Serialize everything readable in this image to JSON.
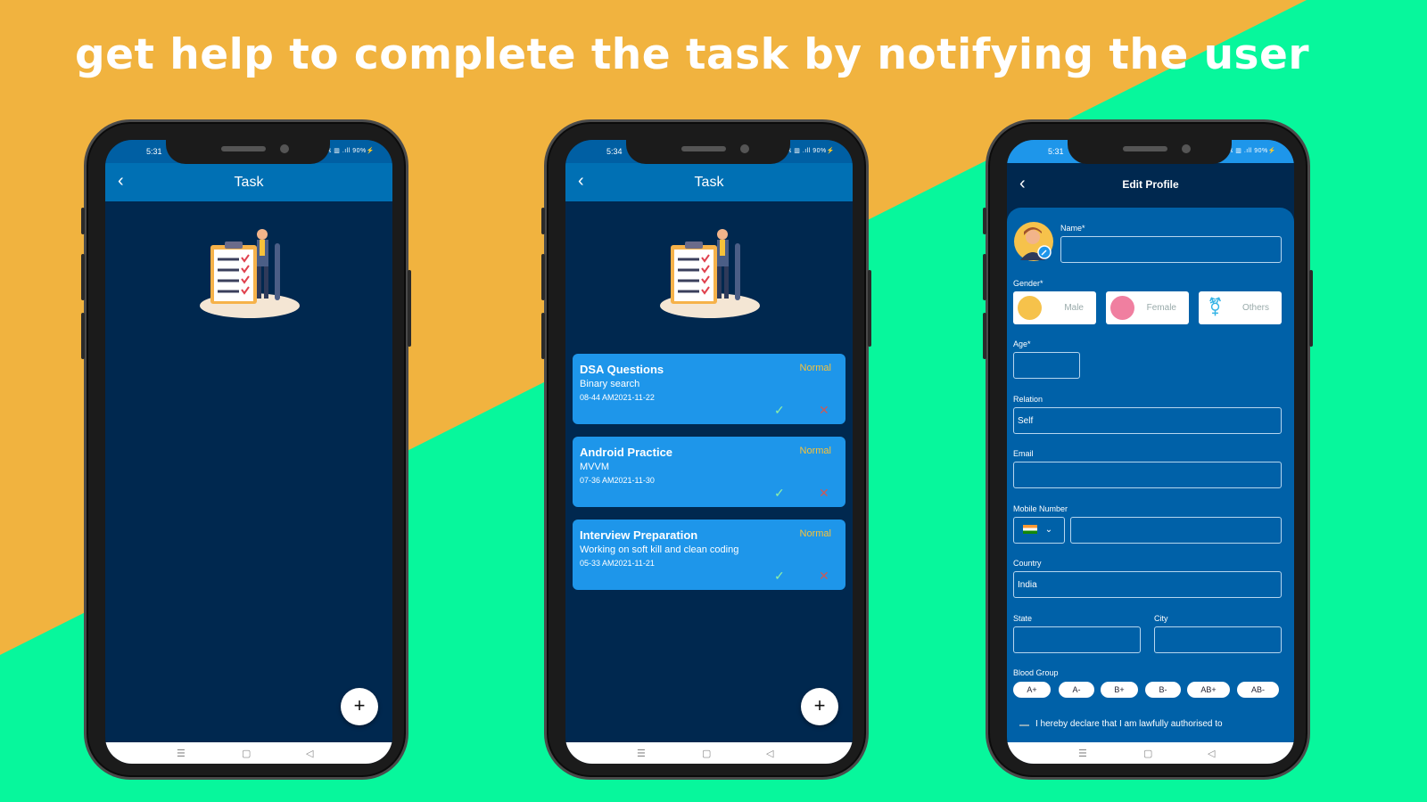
{
  "headline": "get help to complete the task by notifying the user",
  "phones": [
    {
      "status_time": "5:31",
      "status_icons": "ℝ ▥ .ıll 90%⚡",
      "appbar_title": "Task",
      "fab_label": "+",
      "tasks": []
    },
    {
      "status_time": "5:34",
      "status_icons": "ℝ ▥ .ıll 90%⚡",
      "appbar_title": "Task",
      "fab_label": "+",
      "tasks": [
        {
          "title": "DSA Questions",
          "description": "Binary search",
          "datetime": "08-44 AM2021-11-22",
          "priority": "Normal"
        },
        {
          "title": "Android Practice",
          "description": "MVVM",
          "datetime": "07-36 AM2021-11-30",
          "priority": "Normal"
        },
        {
          "title": "Interview Preparation",
          "description": "Working on soft kill and clean coding",
          "datetime": "05-33 AM2021-11-21",
          "priority": "Normal"
        }
      ]
    },
    {
      "status_time": "5:31",
      "status_icons": "ℝ ▥ .ıll 90%⚡",
      "appbar_title": "Edit Profile",
      "form": {
        "name_label": "Name*",
        "name_value": "",
        "gender_label": "Gender*",
        "gender_options": [
          "Male",
          "Female",
          "Others"
        ],
        "age_label": "Age*",
        "age_value": "",
        "relation_label": "Relation",
        "relation_value": "Self",
        "email_label": "Email",
        "email_value": "",
        "mobile_label": "Mobile Number",
        "mobile_value": "",
        "country_label": "Country",
        "country_value": "India",
        "state_label": "State",
        "state_value": "",
        "city_label": "City",
        "city_value": "",
        "blood_group_label": "Blood Group",
        "blood_groups": [
          "A+",
          "A-",
          "B+",
          "B-",
          "AB+",
          "AB-"
        ],
        "declaration": "I hereby declare that I am lawfully authorised to"
      }
    }
  ],
  "colors": {
    "bg_orange": "#f1b33f",
    "bg_green": "#07f79c",
    "screen_bg": "#00284f",
    "appbar": "#0070b4",
    "card": "#1e96ea",
    "priority": "#f7c23a"
  }
}
